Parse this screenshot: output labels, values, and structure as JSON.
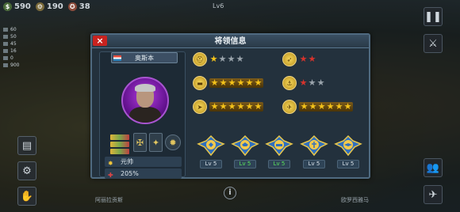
{
  "topbar": {
    "money": "590",
    "industry": "190",
    "medals": "38",
    "level_label": "Lv6"
  },
  "left_stats": [
    "60",
    "50",
    "45",
    "16",
    "0",
    "900"
  ],
  "dialog": {
    "title": "将领信息",
    "close_label": "×"
  },
  "general": {
    "name": "奥斯本",
    "rank": "元帅",
    "bonus": "205%"
  },
  "skills": [
    {
      "icon": "helmet-icon",
      "stars": 1,
      "max": 4,
      "style": "plain"
    },
    {
      "icon": "artillery-icon",
      "stars": 2,
      "max": 2,
      "style": "red"
    },
    {
      "icon": "tank-icon",
      "stars": 6,
      "max": 6,
      "style": "gold"
    },
    {
      "icon": "anchor-icon",
      "stars": 1,
      "max": 3,
      "style": "red"
    },
    {
      "icon": "rocket-icon",
      "stars": 6,
      "max": 6,
      "style": "gold"
    },
    {
      "icon": "aircraft-icon",
      "stars": 6,
      "max": 6,
      "style": "gold"
    }
  ],
  "badges": [
    {
      "label": "Lv 5",
      "green": false
    },
    {
      "label": "Lv 5",
      "green": true
    },
    {
      "label": "Lv 5",
      "green": true
    },
    {
      "label": "Lv 5",
      "green": false
    },
    {
      "label": "Lv 5",
      "green": false
    }
  ],
  "bottom": {
    "left_text": "阿丽拉贡斯",
    "right_text": "欧罗西雅马"
  }
}
